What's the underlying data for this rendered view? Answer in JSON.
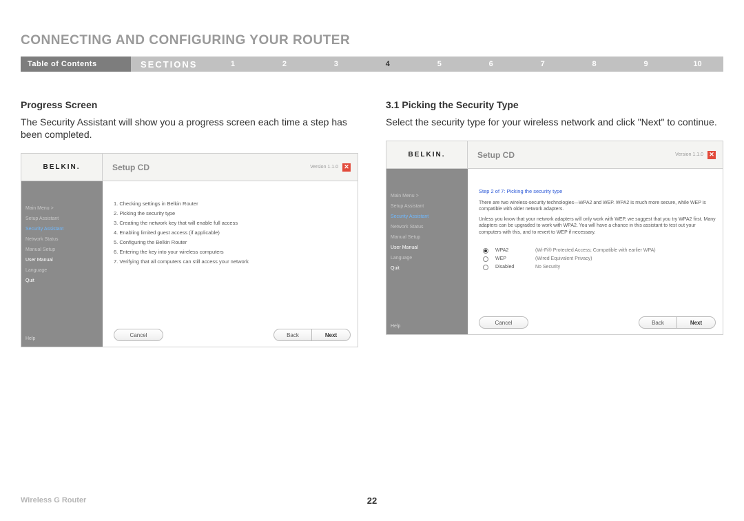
{
  "page_title": "CONNECTING AND CONFIGURING YOUR ROUTER",
  "nav": {
    "toc": "Table of Contents",
    "sections": "SECTIONS",
    "items": [
      "1",
      "2",
      "3",
      "4",
      "5",
      "6",
      "7",
      "8",
      "9",
      "10"
    ],
    "active_index": 3
  },
  "left": {
    "heading": "Progress Screen",
    "body": "The Security Assistant will show you a progress screen each time a step has been completed."
  },
  "right": {
    "heading": "3.1 Picking the Security Type",
    "body": "Select the security type for your wireless network and click \"Next\" to continue."
  },
  "window_common": {
    "brand": "BELKIN.",
    "cd": "Setup CD",
    "version": "Version 1.1.0",
    "close": "✕",
    "sidebar": {
      "main_menu": "Main Menu  >",
      "setup_assistant": "Setup Assistant",
      "security_assistant": "Security Assistant",
      "network_status": "Network Status",
      "manual_setup": "Manual Setup",
      "user_manual": "User Manual",
      "language": "Language",
      "quit": "Quit",
      "help": "Help"
    },
    "buttons": {
      "cancel": "Cancel",
      "back": "Back",
      "next": "Next"
    }
  },
  "win1": {
    "steps": [
      "1. Checking settings in Belkin Router",
      "2. Picking the security type",
      "3. Creating the network key that will enable full access",
      "4. Enabling limited guest access (if applicable)",
      "5. Configuring the Belkin Router",
      "6. Entering the key into your wireless computers",
      "7. Verifying that all computers can still access your network"
    ]
  },
  "win2": {
    "step_title": "Step 2 of 7: Picking the security type",
    "para1": "There are two wireless-security technologies—WPA2 and WEP. WPA2 is much more secure, while WEP is compatible with older network adapters.",
    "para2": "Unless you know that your network adapters will only work with WEP, we suggest that you try WPA2 first. Many adapters can be upgraded to work with WPA2. You will have a chance in this assistant to test out your computers with this, and to revert to WEP if necessary.",
    "options": [
      {
        "value": "WPA2",
        "desc": "(Wi-Fi® Protected Access; Compatible with earlier WPA)",
        "checked": true
      },
      {
        "value": "WEP",
        "desc": "(Wired Equivalent Privacy)",
        "checked": false
      },
      {
        "value": "Disabled",
        "desc": "No Security",
        "checked": false
      }
    ]
  },
  "footer": {
    "product": "Wireless G Router",
    "page": "22"
  }
}
